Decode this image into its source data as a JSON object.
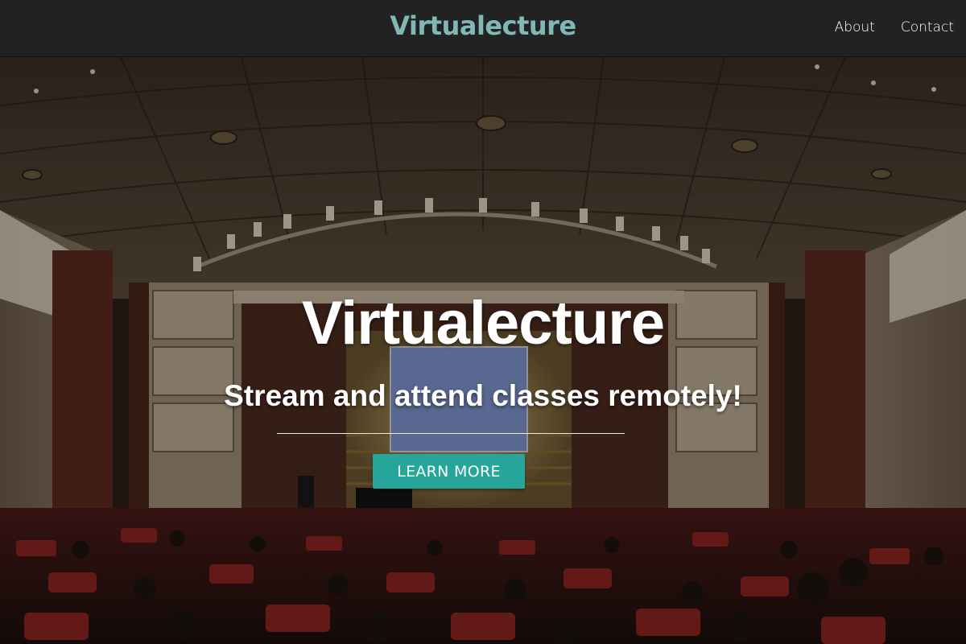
{
  "navbar": {
    "brand": "Virtualecture",
    "links": [
      {
        "label": "About"
      },
      {
        "label": "Contact"
      }
    ]
  },
  "hero": {
    "title": "Virtualecture",
    "subtitle": "Stream and attend classes remotely!",
    "button_label": "LEARN MORE"
  },
  "colors": {
    "navbar_bg": "#222222",
    "brand": "#7fb8b4",
    "button": "#26a69a",
    "text": "#ffffff"
  },
  "background_image": "auditorium-lecture-hall-photo"
}
